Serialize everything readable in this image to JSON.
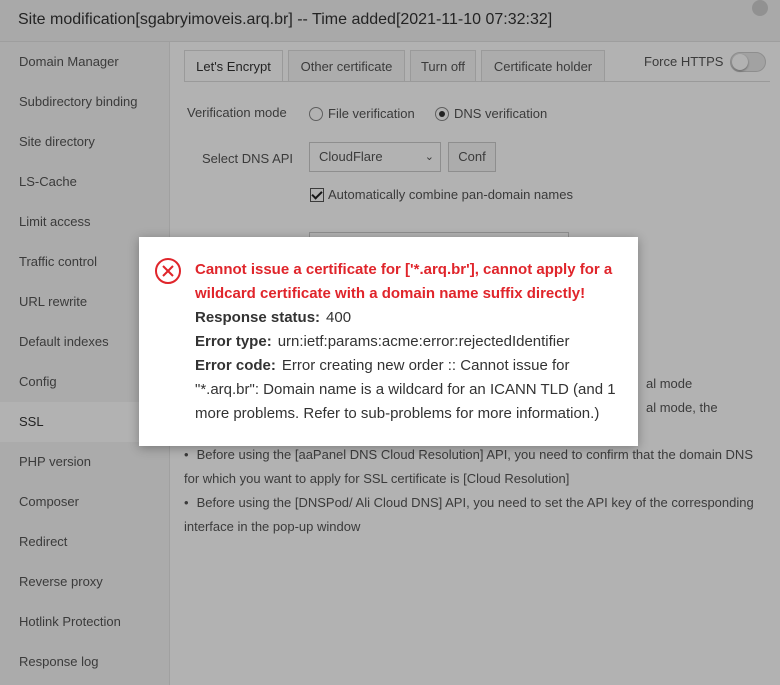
{
  "window": {
    "title": "Site modification[sgabryimoveis.arq.br] -- Time added[2021-11-10 07:32:32]"
  },
  "sidebar": {
    "items": [
      {
        "label": "Domain Manager"
      },
      {
        "label": "Subdirectory binding"
      },
      {
        "label": "Site directory"
      },
      {
        "label": "LS-Cache"
      },
      {
        "label": "Limit access"
      },
      {
        "label": "Traffic control"
      },
      {
        "label": "URL rewrite"
      },
      {
        "label": "Default indexes"
      },
      {
        "label": "Config"
      },
      {
        "label": "SSL",
        "active": true
      },
      {
        "label": "PHP version"
      },
      {
        "label": "Composer"
      },
      {
        "label": "Redirect"
      },
      {
        "label": "Reverse proxy"
      },
      {
        "label": "Hotlink Protection"
      },
      {
        "label": "Response log"
      }
    ]
  },
  "tabs": [
    {
      "label": "Let's Encrypt",
      "active": true
    },
    {
      "label": "Other certificate"
    },
    {
      "label": "Turn off"
    },
    {
      "label": "Certificate holder"
    }
  ],
  "force_https": {
    "label": "Force HTTPS",
    "on": false
  },
  "form": {
    "verification_label": "Verification mode",
    "file_verification": "File verification",
    "dns_verification": "DNS verification",
    "selected_mode": "DNS verification",
    "dns_api_label": "Select DNS API",
    "dns_api_value": "CloudFlare",
    "conf_button": "Conf",
    "combine_label": "Automatically combine pan-domain names",
    "combine_checked": true
  },
  "obscured_fragments": {
    "frag1": "al mode",
    "frag2": "al mode, the"
  },
  "tips": [
    "Before using the [aaPanel DNS Cloud Resolution] API, you need to confirm that the domain DNS for which you want to apply for SSL certificate is [Cloud Resolution]",
    "Before using the [DNSPod/ Ali Cloud DNS] API, you need to set the API key of the corresponding interface in the pop-up window"
  ],
  "dialog": {
    "title": "Cannot issue a certificate for ['*.arq.br'], cannot apply for a wildcard certificate with a domain name suffix directly!",
    "status_label": "Response status:",
    "status_value": "400",
    "type_label": "Error type:",
    "type_value": "urn:ietf:params:acme:error:rejectedIdentifier",
    "code_label": "Error code:",
    "code_value": "Error creating new order :: Cannot issue for \"*.arq.br\": Domain name is a wildcard for an ICANN TLD (and 1 more problems. Refer to sub-problems for more information.)"
  },
  "colors": {
    "error": "#e0252b",
    "overlay": "rgba(0,0,0,0.3)"
  }
}
